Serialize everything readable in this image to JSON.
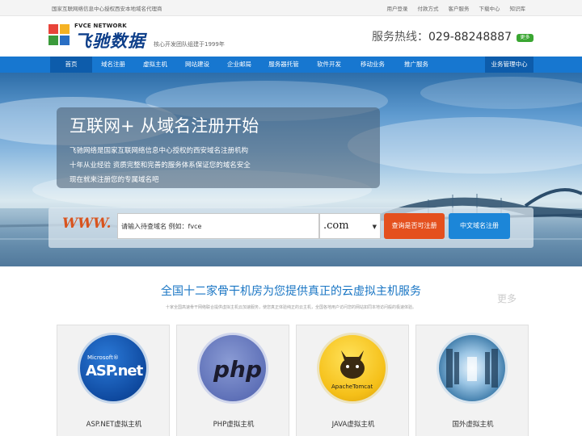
{
  "topbar": {
    "notice": "国家互联网络信息中心授权西安本地域名代理商",
    "links": [
      "用户登录",
      "付款方式",
      "客户服务",
      "下载中心",
      "知识库"
    ]
  },
  "header": {
    "logo_en": "FVCE NETWORK",
    "logo_cn": "飞驰数据",
    "slogan": "核心开发团队组建于1999年",
    "hotline_label": "服务热线：",
    "hotline_number": "029-88248887",
    "more_badge": "更多"
  },
  "nav": {
    "items": [
      "首页",
      "域名注册",
      "虚拟主机",
      "网站建设",
      "企业邮局",
      "服务器托管",
      "软件开发",
      "移动业务",
      "推广服务"
    ],
    "right_item": "业务管理中心"
  },
  "hero": {
    "title": "互联网+ 从域名注册开始",
    "lines": [
      "飞驰网络是国家互联网络信息中心授权的西安域名注册机构",
      "十年从业经验 资质完整和完善的服务体系保证您的域名安全",
      "现在就来注册您的专属域名吧"
    ]
  },
  "search": {
    "www": "WWW.",
    "input_value": "请输入待查域名 例如：fvce",
    "tld_selected": ".com",
    "check_button": "查询是否可注册",
    "cn_button": "中文域名注册"
  },
  "section": {
    "title": "全国十二家骨干机房为您提供真正的云虚拟主机服务",
    "more": "更多",
    "description": "十家全国高速骨干网络联合提供虚拟主机云加速服务，使您真正体验纯正的云主机，全国各地用户访问您的网站如同本地访问般的极速体验。"
  },
  "cards": [
    {
      "label": "ASP.NET虚拟主机",
      "logo_text_top": "Microsoft®",
      "logo_text_main": "ASP.net"
    },
    {
      "label": "PHP虚拟主机",
      "logo_text_main": "php"
    },
    {
      "label": "JAVA虚拟主机",
      "logo_text_main": "ApacheTomcat"
    },
    {
      "label": "国外虚拟主机"
    }
  ],
  "colors": {
    "nav_bg": "#1777d0",
    "nav_active": "#0d5cab",
    "accent_orange": "#e4501e",
    "accent_blue": "#1c86d8",
    "badge_green": "#3aa632",
    "title_blue": "#1a76c4"
  }
}
